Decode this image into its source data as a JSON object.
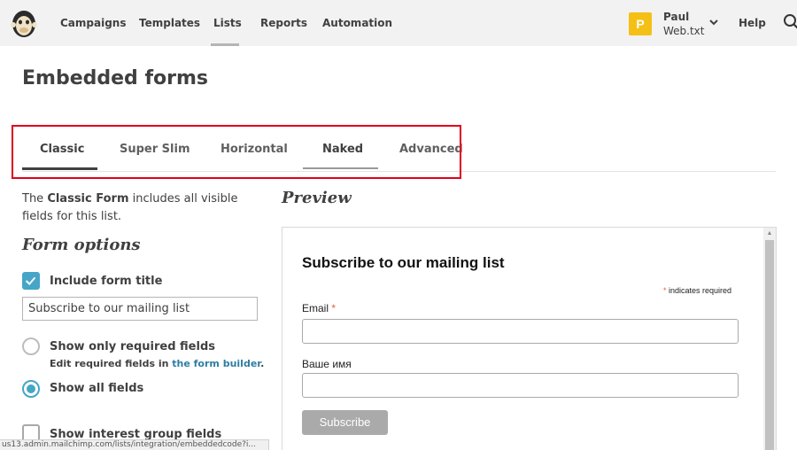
{
  "nav": {
    "items": [
      {
        "label": "Campaigns"
      },
      {
        "label": "Templates"
      },
      {
        "label": "Lists"
      },
      {
        "label": "Reports"
      },
      {
        "label": "Automation"
      }
    ],
    "active": "Lists",
    "account": {
      "avatar_letter": "P",
      "name": "Paul",
      "org": "Web.txt"
    },
    "help_label": "Help"
  },
  "page": {
    "title": "Embedded forms"
  },
  "tabs": [
    {
      "label": "Classic",
      "state": "selected"
    },
    {
      "label": "Super Slim",
      "state": "normal"
    },
    {
      "label": "Horizontal",
      "state": "normal"
    },
    {
      "label": "Naked",
      "state": "hover"
    },
    {
      "label": "Advanced",
      "state": "normal"
    }
  ],
  "left": {
    "intro_pre": "The ",
    "intro_bold": "Classic Form",
    "intro_post": " includes all visible fields for this list.",
    "form_options_title": "Form options",
    "include_title": {
      "label": "Include form title",
      "checked": true
    },
    "title_value": "Subscribe to our mailing list",
    "required_only": {
      "label": "Show only required fields",
      "selected": false
    },
    "edit_note_pre": "Edit required fields in ",
    "edit_note_link": "the form builder",
    "edit_note_post": ".",
    "show_all": {
      "label": "Show all fields",
      "selected": true
    },
    "interest_groups": {
      "label": "Show interest group fields",
      "checked": false
    }
  },
  "preview": {
    "label": "Preview",
    "form_title": "Subscribe to our mailing list",
    "required_star": "*",
    "required_note": " indicates required",
    "email_label": "Email ",
    "email_star": "*",
    "name_label": "Ваше имя",
    "button_label": "Subscribe"
  },
  "status_url": "us13.admin.mailchimp.com/lists/integration/embeddedcode?i...",
  "colors": {
    "accent": "#46a6c7",
    "highlight": "#e0001b",
    "link": "#2d7ea2",
    "avatar": "#f5c016"
  }
}
